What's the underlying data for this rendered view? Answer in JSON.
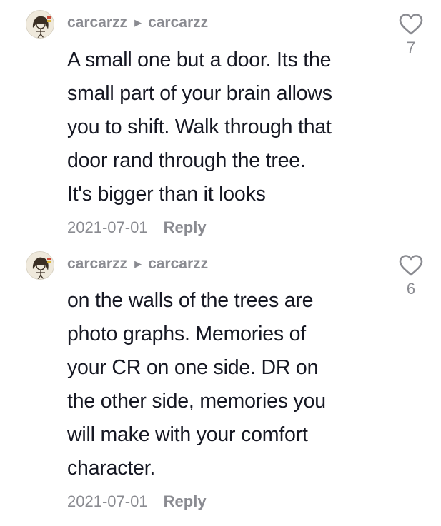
{
  "comments": [
    {
      "author": "carcarzz",
      "reply_to": "carcarzz",
      "lines": [
        "A small one but a door. Its the",
        "small part of your brain allows",
        "you to shift. Walk through that",
        "door rand through the tree.",
        "It's bigger than it looks"
      ],
      "date": "2021-07-01",
      "reply_label": "Reply",
      "likes": "7"
    },
    {
      "author": "carcarzz",
      "reply_to": "carcarzz",
      "lines": [
        "on the walls of the trees are",
        "photo graphs. Memories of",
        "your CR on one side. DR on",
        "the other side, memories you",
        "will make with your comfort",
        "character."
      ],
      "date": "2021-07-01",
      "reply_label": "Reply",
      "likes": "6"
    }
  ],
  "icons": {
    "reply_arrow": "play-triangle-icon",
    "like": "heart-outline-icon"
  },
  "colors": {
    "text": "#161823",
    "muted": "#8a8b91"
  }
}
